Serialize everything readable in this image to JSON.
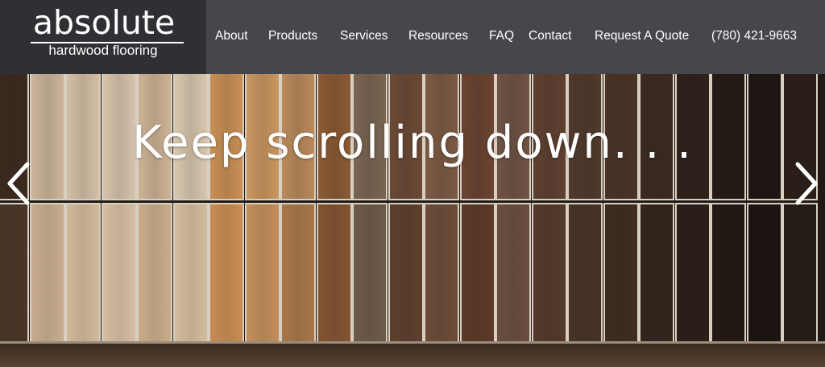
{
  "logo": {
    "main": "absolute",
    "sub": "hardwood flooring"
  },
  "nav": {
    "items": [
      {
        "label": "About"
      },
      {
        "label": "Products"
      },
      {
        "label": "Services"
      },
      {
        "label": "Resources"
      },
      {
        "label": "FAQ"
      },
      {
        "label": "Contact"
      },
      {
        "label": "Request A Quote"
      },
      {
        "label": "(780) 421-9663"
      }
    ]
  },
  "hero": {
    "headline": "Keep scrolling down. . .",
    "prev_icon": "chevron-left-icon",
    "next_icon": "chevron-right-icon"
  },
  "colors": {
    "header_bg": "#45474c",
    "logo_bg": "#2f3033",
    "text": "#ffffff"
  }
}
